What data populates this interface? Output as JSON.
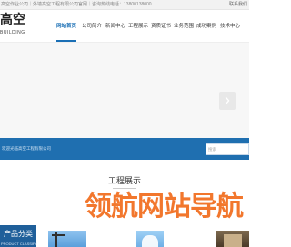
{
  "topbar": {
    "text": "高空作业公司｜外墙高空工程有限公司官网｜咨询热线电话：13800138000",
    "right": "联系我们"
  },
  "logo": {
    "name": "高空",
    "subtitle": "BUILDING"
  },
  "nav": {
    "items": [
      {
        "label": "网站首页",
        "active": true
      },
      {
        "label": "公司简介",
        "active": false
      },
      {
        "label": "新闻中心",
        "active": false
      },
      {
        "label": "工程展示",
        "active": false
      },
      {
        "label": "资质证书",
        "active": false
      },
      {
        "label": "业务范围",
        "active": false
      },
      {
        "label": "成功案例",
        "active": false
      },
      {
        "label": "技术中心",
        "active": false
      }
    ]
  },
  "banner": {
    "next_glyph": "›"
  },
  "bluebar": {
    "text": "欢迎光临高空工程有限公司",
    "search_placeholder": "搜索"
  },
  "section": {
    "title": "工程展示"
  },
  "watermark": {
    "text": "领航网站导航"
  },
  "category": {
    "title": "产品分类",
    "subtitle": "PRODUCT CLASSIFY"
  },
  "colors": {
    "accent": "#1a6fb5",
    "bluebar": "#1f6fb0",
    "watermark": "#f05a00"
  }
}
